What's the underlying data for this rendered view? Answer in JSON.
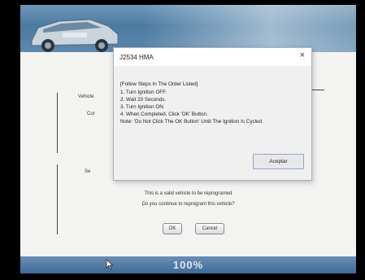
{
  "dialog": {
    "title": "J2534 HMA",
    "close_glyph": "×",
    "lines": [
      "[Follow Steps In The Order Listed]",
      "1. Turn Ignition OFF.",
      "2. Wait 20 Seconds.",
      "3. Turn Ignition ON.",
      "4. When Completed, Click 'OK' Button.",
      "Note: 'Do Not Click The OK Button' Until The Ignition Is Cycled."
    ],
    "accept_label": "Aceptar"
  },
  "background": {
    "side_labels": [
      "Vehicle",
      "Cur",
      "Se"
    ],
    "prompt_line_1": "This is a valid vehicle to be reprogramed",
    "prompt_line_2": "Do you continue to reprogram this vehicle?",
    "ok_label": "OK",
    "cancel_label": "Cancel"
  },
  "progress": {
    "label": "100%",
    "value": 1.0
  },
  "colors": {
    "header_blue": "#4b7aa1",
    "progress_blue": "#3f6a98",
    "field_blue": "#4d7fc4"
  },
  "icons": {
    "cursor": "mouse-pointer-icon",
    "close": "close-icon"
  }
}
